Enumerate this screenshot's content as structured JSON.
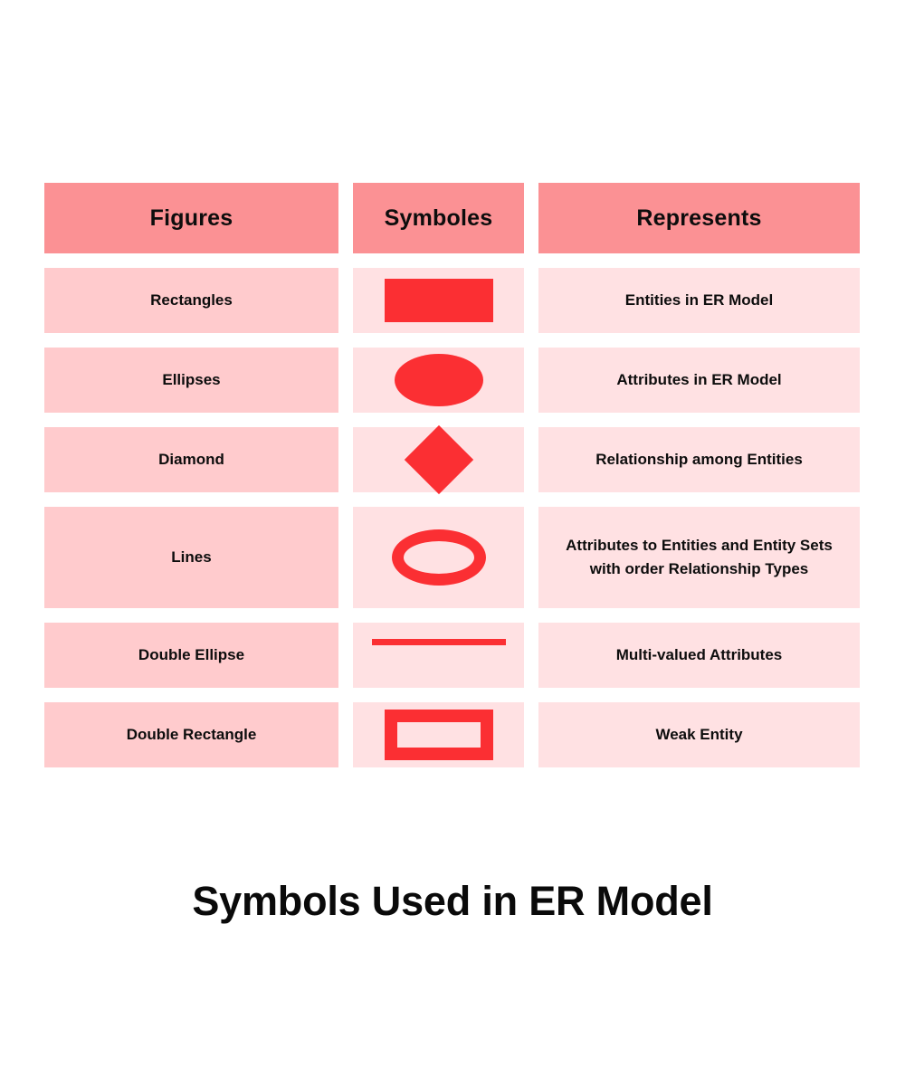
{
  "title": "Symbols Used in ER Model",
  "colors": {
    "header_bg": "#fb9194",
    "figures_cell_bg": "#ffcbcd",
    "light_cell_bg": "#ffe1e3",
    "symbol_red": "#fb2f33",
    "text": "#0d0d0d",
    "page_bg": "#ffffff"
  },
  "table": {
    "columns": [
      {
        "key": "figures",
        "label": "Figures"
      },
      {
        "key": "symboles",
        "label": "Symboles"
      },
      {
        "key": "represents",
        "label": "Represents"
      }
    ],
    "rows": [
      {
        "figure": "Rectangles",
        "symbol_name": "rectangle-shape",
        "represents": "Entities in ER Model"
      },
      {
        "figure": "Ellipses",
        "symbol_name": "ellipse-shape",
        "represents": "Attributes in ER Model"
      },
      {
        "figure": "Diamond",
        "symbol_name": "diamond-shape",
        "represents": "Relationship among Entities"
      },
      {
        "figure": "Lines",
        "symbol_name": "double-ellipse-shape",
        "represents": "Attributes to Entities and Entity Sets with order Relationship Types"
      },
      {
        "figure": "Double Ellipse",
        "symbol_name": "line-shape",
        "represents": "Multi-valued Attributes"
      },
      {
        "figure": "Double Rectangle",
        "symbol_name": "double-rectangle-shape",
        "represents": "Weak Entity"
      }
    ]
  }
}
